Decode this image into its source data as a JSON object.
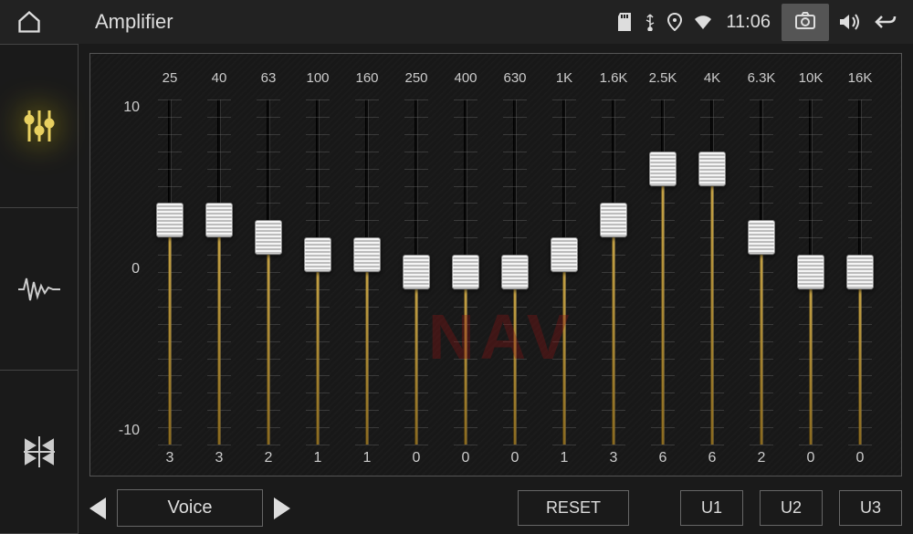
{
  "header": {
    "title": "Amplifier",
    "time": "11:06"
  },
  "yaxis": {
    "max": "10",
    "mid": "0",
    "min": "-10"
  },
  "bands": [
    {
      "freq": "25",
      "val": 3
    },
    {
      "freq": "40",
      "val": 3
    },
    {
      "freq": "63",
      "val": 2
    },
    {
      "freq": "100",
      "val": 1
    },
    {
      "freq": "160",
      "val": 1
    },
    {
      "freq": "250",
      "val": 0
    },
    {
      "freq": "400",
      "val": 0
    },
    {
      "freq": "630",
      "val": 0
    },
    {
      "freq": "1K",
      "val": 1
    },
    {
      "freq": "1.6K",
      "val": 3
    },
    {
      "freq": "2.5K",
      "val": 6
    },
    {
      "freq": "4K",
      "val": 6
    },
    {
      "freq": "6.3K",
      "val": 2
    },
    {
      "freq": "10K",
      "val": 0
    },
    {
      "freq": "16K",
      "val": 0
    }
  ],
  "preset": {
    "label": "Voice",
    "reset": "RESET",
    "u1": "U1",
    "u2": "U2",
    "u3": "U3"
  },
  "watermark": "NAV"
}
